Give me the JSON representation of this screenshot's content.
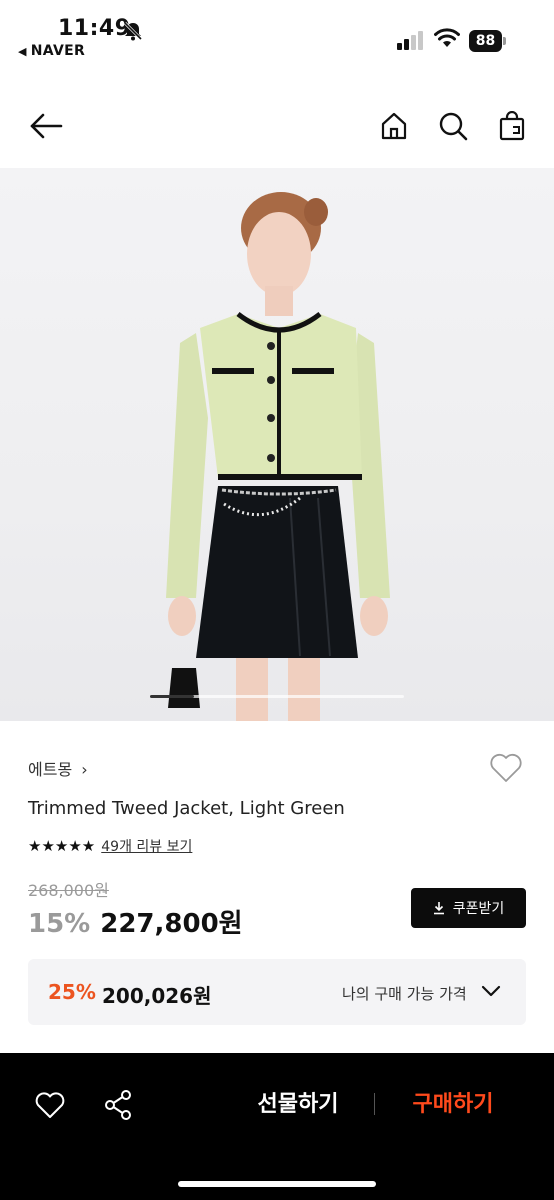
{
  "status_bar": {
    "time": "11:49",
    "back_app": "NAVER",
    "battery": "88"
  },
  "nav": {
    "icons": [
      "back-arrow-icon",
      "home-icon",
      "search-icon",
      "shopping-bag-icon"
    ]
  },
  "hero": {
    "image": "model in light green tweed jacket and black pleated mini skirt",
    "slide_position": 1
  },
  "product": {
    "brand": "에트몽",
    "name": "Trimmed Tweed Jacket, Light Green",
    "rating": 5,
    "stars": "★★★★★",
    "review_link": "49개 리뷰 보기",
    "original_price": "268,000원",
    "discount": "15%",
    "price": "227,800원",
    "coupon_label": "쿠폰받기"
  },
  "my_price": {
    "discount": "25%",
    "price": "200,026원",
    "label": "나의 구매 가능 가격"
  },
  "bottom_bar": {
    "gift_label": "선물하기",
    "buy_label": "구매하기"
  },
  "colors": {
    "accent": "#ec5420",
    "buy": "#ff4a1c",
    "dark": "#0c0c0c",
    "box_bg": "#f4f4f6"
  }
}
